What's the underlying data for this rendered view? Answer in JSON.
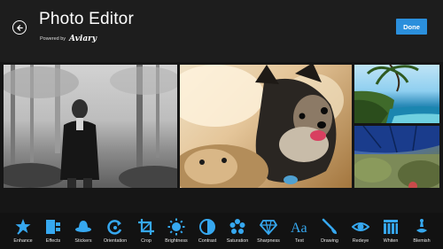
{
  "header": {
    "title": "Photo Editor",
    "powered_by": "Powered by",
    "brand": "Aviary",
    "done_label": "Done"
  },
  "colors": {
    "accent": "#2b8fdc",
    "icon_blue": "#36a8f0",
    "background": "#1d1d1d",
    "toolbar": "#121212"
  },
  "tools": [
    {
      "label": "Enhance",
      "icon": "star-wand-icon"
    },
    {
      "label": "Effects",
      "icon": "effects-icon"
    },
    {
      "label": "Stickers",
      "icon": "hat-icon"
    },
    {
      "label": "Orientation",
      "icon": "rotate-icon"
    },
    {
      "label": "Crop",
      "icon": "crop-icon"
    },
    {
      "label": "Brightness",
      "icon": "sun-icon"
    },
    {
      "label": "Contrast",
      "icon": "contrast-icon"
    },
    {
      "label": "Saturation",
      "icon": "saturation-icon"
    },
    {
      "label": "Sharpness",
      "icon": "diamond-icon"
    },
    {
      "label": "Text",
      "icon": "text-icon"
    },
    {
      "label": "Drawing",
      "icon": "brush-icon"
    },
    {
      "label": "Redeye",
      "icon": "eye-icon"
    },
    {
      "label": "Whiten",
      "icon": "whiten-icon"
    },
    {
      "label": "Blemish",
      "icon": "blemish-icon"
    }
  ]
}
